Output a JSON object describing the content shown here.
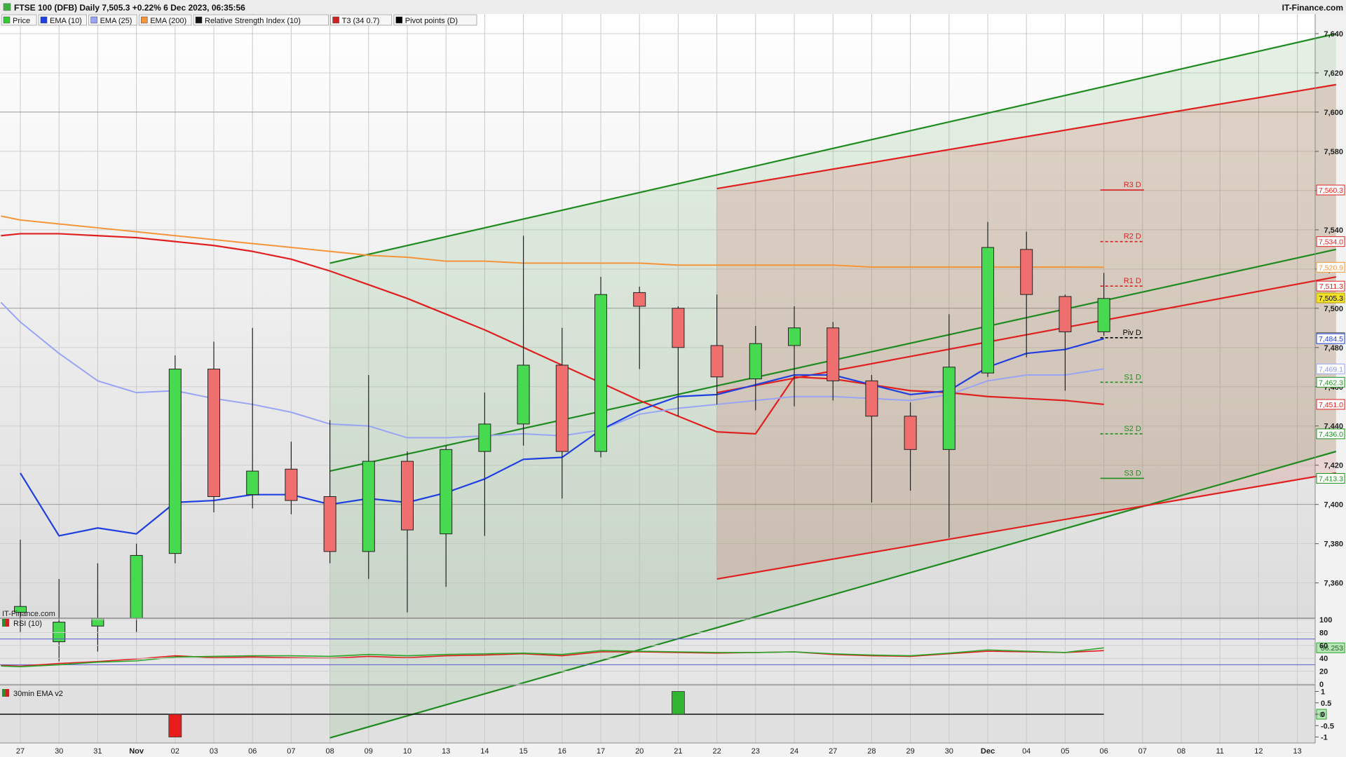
{
  "header": {
    "title": "FTSE 100 (DFB) Daily 7,505.3 +0.22% 6 Dec 2023, 06:35:56",
    "brand": "IT-Finance.com"
  },
  "legend": [
    {
      "label": "Price",
      "color": "#33cc33"
    },
    {
      "label": "EMA (10)",
      "color": "#1f3fe0"
    },
    {
      "label": "EMA (25)",
      "color": "#9aa4f4"
    },
    {
      "label": "EMA (200)",
      "color": "#f5953a"
    },
    {
      "label": "Relative Strength Index (10)",
      "color": "#111111"
    },
    {
      "label": "T3 (34 0.7)",
      "color": "#cc2222"
    },
    {
      "label": "Pivot points (D)",
      "color": "#000000"
    }
  ],
  "watermark": "IT-Finance.com",
  "rsi_panel": {
    "label": "RSI (10)",
    "ticks": [
      "100",
      "80",
      "60",
      "40",
      "20",
      "0"
    ],
    "value_label": "56.253"
  },
  "ema_panel": {
    "label": "30min EMA v2",
    "ticks": [
      "1",
      "0.5",
      "0",
      "-0.5",
      "-1"
    ],
    "value_label": "0"
  },
  "chart_data": {
    "type": "candlestick",
    "x_labels": [
      "27",
      "30",
      "31",
      "Nov",
      "02",
      "03",
      "06",
      "07",
      "08",
      "09",
      "10",
      "13",
      "14",
      "15",
      "16",
      "17",
      "20",
      "21",
      "22",
      "23",
      "24",
      "27",
      "28",
      "29",
      "30",
      "Dec",
      "04",
      "05",
      "06",
      "07",
      "08",
      "11",
      "12",
      "13"
    ],
    "ylim": [
      7342,
      7650
    ],
    "y_ticks": [
      7360,
      7380,
      7400,
      7420,
      7440,
      7460,
      7480,
      7500,
      7520,
      7540,
      7560,
      7580,
      7600,
      7620,
      7640
    ],
    "y_tick_labels": [
      "7,360",
      "7,380",
      "7,400",
      "7,420",
      "7,440",
      "7,460",
      "7,480",
      "7,500",
      "7,520",
      "7,540",
      "7,560",
      "7,580",
      "7,600",
      "7,620",
      "7,640"
    ],
    "candles": [
      {
        "i": 0,
        "o": 7345,
        "h": 7382,
        "l": 7335,
        "c": 7348
      },
      {
        "i": 1,
        "o": 7330,
        "h": 7362,
        "l": 7320,
        "c": 7340
      },
      {
        "i": 2,
        "o": 7338,
        "h": 7370,
        "l": 7325,
        "c": 7342
      },
      {
        "i": 3,
        "o": 7342,
        "h": 7380,
        "l": 7335,
        "c": 7374
      },
      {
        "i": 4,
        "o": 7375,
        "h": 7476,
        "l": 7370,
        "c": 7469
      },
      {
        "i": 5,
        "o": 7469,
        "h": 7483,
        "l": 7396,
        "c": 7404
      },
      {
        "i": 6,
        "o": 7405,
        "h": 7490,
        "l": 7398,
        "c": 7417
      },
      {
        "i": 7,
        "o": 7418,
        "h": 7432,
        "l": 7395,
        "c": 7402
      },
      {
        "i": 8,
        "o": 7404,
        "h": 7443,
        "l": 7370,
        "c": 7376
      },
      {
        "i": 9,
        "o": 7376,
        "h": 7466,
        "l": 7362,
        "c": 7422
      },
      {
        "i": 10,
        "o": 7422,
        "h": 7427,
        "l": 7345,
        "c": 7387
      },
      {
        "i": 11,
        "o": 7385,
        "h": 7430,
        "l": 7358,
        "c": 7428
      },
      {
        "i": 12,
        "o": 7427,
        "h": 7457,
        "l": 7384,
        "c": 7441
      },
      {
        "i": 13,
        "o": 7441,
        "h": 7537,
        "l": 7430,
        "c": 7471
      },
      {
        "i": 14,
        "o": 7471,
        "h": 7490,
        "l": 7403,
        "c": 7427
      },
      {
        "i": 15,
        "o": 7427,
        "h": 7516,
        "l": 7424,
        "c": 7507
      },
      {
        "i": 16,
        "o": 7508,
        "h": 7511,
        "l": 7469,
        "c": 7501
      },
      {
        "i": 17,
        "o": 7500,
        "h": 7501,
        "l": 7445,
        "c": 7480
      },
      {
        "i": 18,
        "o": 7481,
        "h": 7507,
        "l": 7451,
        "c": 7465
      },
      {
        "i": 19,
        "o": 7464,
        "h": 7491,
        "l": 7448,
        "c": 7482
      },
      {
        "i": 20,
        "o": 7481,
        "h": 7501,
        "l": 7450,
        "c": 7490
      },
      {
        "i": 21,
        "o": 7490,
        "h": 7493,
        "l": 7453,
        "c": 7463
      },
      {
        "i": 22,
        "o": 7463,
        "h": 7466,
        "l": 7401,
        "c": 7445
      },
      {
        "i": 23,
        "o": 7445,
        "h": 7452,
        "l": 7407,
        "c": 7428
      },
      {
        "i": 24,
        "o": 7428,
        "h": 7497,
        "l": 7383,
        "c": 7470
      },
      {
        "i": 25,
        "o": 7467,
        "h": 7544,
        "l": 7465,
        "c": 7531
      },
      {
        "i": 26,
        "o": 7530,
        "h": 7539,
        "l": 7475,
        "c": 7507
      },
      {
        "i": 27,
        "o": 7506,
        "h": 7507,
        "l": 7458,
        "c": 7488
      },
      {
        "i": 28,
        "o": 7488,
        "h": 7518,
        "l": 7486,
        "c": 7505
      }
    ],
    "ema10": [
      [
        0,
        7416
      ],
      [
        1,
        7384
      ],
      [
        2,
        7388
      ],
      [
        3,
        7385
      ],
      [
        4,
        7401
      ],
      [
        5,
        7402
      ],
      [
        6,
        7405
      ],
      [
        7,
        7405
      ],
      [
        8,
        7400
      ],
      [
        9,
        7403
      ],
      [
        10,
        7401
      ],
      [
        11,
        7406
      ],
      [
        12,
        7413
      ],
      [
        13,
        7423
      ],
      [
        14,
        7424
      ],
      [
        15,
        7438
      ],
      [
        16,
        7448
      ],
      [
        17,
        7455
      ],
      [
        18,
        7456
      ],
      [
        19,
        7461
      ],
      [
        20,
        7466
      ],
      [
        21,
        7466
      ],
      [
        22,
        7461
      ],
      [
        23,
        7456
      ],
      [
        24,
        7458
      ],
      [
        25,
        7470
      ],
      [
        26,
        7477
      ],
      [
        27,
        7479
      ],
      [
        28,
        7484.5
      ]
    ],
    "ema25": [
      [
        -0.5,
        7503
      ],
      [
        0,
        7493
      ],
      [
        1,
        7477
      ],
      [
        2,
        7463
      ],
      [
        3,
        7457
      ],
      [
        4,
        7458
      ],
      [
        5,
        7454
      ],
      [
        6,
        7451
      ],
      [
        7,
        7447
      ],
      [
        8,
        7441
      ],
      [
        9,
        7440
      ],
      [
        10,
        7434
      ],
      [
        11,
        7434
      ],
      [
        12,
        7435
      ],
      [
        13,
        7436
      ],
      [
        14,
        7435
      ],
      [
        15,
        7438
      ],
      [
        16,
        7446
      ],
      [
        17,
        7449
      ],
      [
        18,
        7451
      ],
      [
        19,
        7453
      ],
      [
        20,
        7455
      ],
      [
        21,
        7455
      ],
      [
        22,
        7454
      ],
      [
        23,
        7453
      ],
      [
        24,
        7456
      ],
      [
        25,
        7463
      ],
      [
        26,
        7466
      ],
      [
        27,
        7466
      ],
      [
        28,
        7469.1
      ]
    ],
    "ema200": [
      [
        -0.5,
        7547
      ],
      [
        0,
        7545
      ],
      [
        1,
        7543
      ],
      [
        2,
        7541
      ],
      [
        3,
        7539
      ],
      [
        4,
        7537
      ],
      [
        5,
        7535
      ],
      [
        6,
        7533
      ],
      [
        7,
        7531
      ],
      [
        8,
        7529
      ],
      [
        9,
        7527
      ],
      [
        10,
        7526
      ],
      [
        11,
        7524
      ],
      [
        12,
        7524
      ],
      [
        13,
        7523
      ],
      [
        14,
        7523
      ],
      [
        15,
        7523
      ],
      [
        16,
        7523
      ],
      [
        17,
        7522
      ],
      [
        18,
        7522
      ],
      [
        19,
        7522
      ],
      [
        20,
        7522
      ],
      [
        21,
        7522
      ],
      [
        22,
        7521
      ],
      [
        23,
        7521
      ],
      [
        24,
        7521
      ],
      [
        25,
        7521
      ],
      [
        26,
        7521
      ],
      [
        27,
        7521
      ],
      [
        28,
        7520.9
      ]
    ],
    "t3": [
      [
        -0.5,
        7537
      ],
      [
        0,
        7538
      ],
      [
        1,
        7538
      ],
      [
        2,
        7537
      ],
      [
        3,
        7536
      ],
      [
        4,
        7534
      ],
      [
        5,
        7532
      ],
      [
        6,
        7529
      ],
      [
        7,
        7525
      ],
      [
        8,
        7519
      ],
      [
        9,
        7512
      ],
      [
        10,
        7505
      ],
      [
        11,
        7497
      ],
      [
        12,
        7489
      ],
      [
        13,
        7480
      ],
      [
        14,
        7471
      ],
      [
        15,
        7462
      ],
      [
        16,
        7453
      ],
      [
        17,
        7445
      ],
      [
        18,
        7437
      ],
      [
        19,
        7436
      ],
      [
        20,
        7465
      ],
      [
        21,
        7464
      ],
      [
        22,
        7461
      ],
      [
        23,
        7458
      ],
      [
        24,
        7457
      ],
      [
        25,
        7455
      ],
      [
        26,
        7454
      ],
      [
        27,
        7453
      ],
      [
        28,
        7451.0
      ]
    ],
    "channels": {
      "green_zone": {
        "x0": 8,
        "x1": 34,
        "upper": [
          7523,
          7640
        ],
        "mid": [
          7417,
          7530
        ],
        "lower": [
          7281,
          7427
        ]
      },
      "red_zone": {
        "x0": 18,
        "x1": 34,
        "upper": [
          7561,
          7614
        ],
        "mid": [
          7457,
          7516
        ],
        "lower": [
          7362,
          7416
        ]
      }
    },
    "pivots": [
      {
        "label": "R3 D",
        "value": 7560.3,
        "color": "#e02020"
      },
      {
        "label": "R2 D",
        "value": 7534.0,
        "color": "#e02020"
      },
      {
        "label": "R1 D",
        "value": 7511.3,
        "color": "#e02020"
      },
      {
        "label": "Piv D",
        "value": 7485.0,
        "color": "#000000"
      },
      {
        "label": "S1 D",
        "value": 7462.3,
        "color": "#1f8f1f"
      },
      {
        "label": "S2 D",
        "value": 7436.0,
        "color": "#1f8f1f"
      },
      {
        "label": "S3 D",
        "value": 7413.3,
        "color": "#1f8f1f"
      }
    ],
    "axis_tags": [
      {
        "text": "7,560.3",
        "value": 7560.3,
        "bg": "#ffffff",
        "fg": "#e02020",
        "border": "#e02020"
      },
      {
        "text": "7,534.0",
        "value": 7534.0,
        "bg": "#ffffff",
        "fg": "#e02020",
        "border": "#e02020"
      },
      {
        "text": "7,520.9",
        "value": 7520.9,
        "bg": "#ffffff",
        "fg": "#f5953a",
        "border": "#f5953a"
      },
      {
        "text": "7,511.3",
        "value": 7511.3,
        "bg": "#ffffff",
        "fg": "#e02020",
        "border": "#e02020"
      },
      {
        "text": "7,505.3",
        "value": 7505.3,
        "bg": "#f4e12a",
        "fg": "#000000",
        "border": "#b49f00"
      },
      {
        "text": "7,485.0",
        "value": 7485.0,
        "bg": "#ffffff",
        "fg": "#000000",
        "border": "#444444"
      },
      {
        "text": "7,484.5",
        "value": 7484.5,
        "bg": "#ffffff",
        "fg": "#1f3fe0",
        "border": "#1f3fe0"
      },
      {
        "text": "7,469.1",
        "value": 7469.1,
        "bg": "#ffffff",
        "fg": "#8f97ee",
        "border": "#9aa4f4"
      },
      {
        "text": "7,462.3",
        "value": 7462.3,
        "bg": "#ffffff",
        "fg": "#1f8f1f",
        "border": "#1f8f1f"
      },
      {
        "text": "7,451.0",
        "value": 7451.0,
        "bg": "#ffffff",
        "fg": "#e02020",
        "border": "#e02020"
      },
      {
        "text": "7,436.0",
        "value": 7436.0,
        "bg": "#ffffff",
        "fg": "#1f8f1f",
        "border": "#1f8f1f"
      },
      {
        "text": "7,413.3",
        "value": 7413.3,
        "bg": "#ffffff",
        "fg": "#1f8f1f",
        "border": "#1f8f1f"
      }
    ],
    "rsi": {
      "ylim": [
        0,
        100
      ],
      "levels": [
        70,
        30
      ],
      "rsi": [
        [
          -0.5,
          28
        ],
        [
          0,
          27
        ],
        [
          1,
          30
        ],
        [
          2,
          34
        ],
        [
          3,
          36
        ],
        [
          4,
          42
        ],
        [
          5,
          43
        ],
        [
          6,
          44
        ],
        [
          7,
          44
        ],
        [
          8,
          43
        ],
        [
          9,
          46
        ],
        [
          10,
          44
        ],
        [
          11,
          46
        ],
        [
          12,
          47
        ],
        [
          13,
          48
        ],
        [
          14,
          46
        ],
        [
          15,
          52
        ],
        [
          16,
          51
        ],
        [
          17,
          50
        ],
        [
          18,
          49
        ],
        [
          19,
          49
        ],
        [
          20,
          50
        ],
        [
          21,
          47
        ],
        [
          22,
          45
        ],
        [
          23,
          44
        ],
        [
          24,
          48
        ],
        [
          25,
          53
        ],
        [
          26,
          51
        ],
        [
          27,
          49
        ],
        [
          28,
          56.253
        ]
      ],
      "signal": [
        [
          -0.5,
          29
        ],
        [
          0,
          28
        ],
        [
          1,
          32
        ],
        [
          2,
          35
        ],
        [
          3,
          39
        ],
        [
          4,
          44
        ],
        [
          5,
          41
        ],
        [
          6,
          42
        ],
        [
          7,
          41
        ],
        [
          8,
          40
        ],
        [
          9,
          43
        ],
        [
          10,
          41
        ],
        [
          11,
          44
        ],
        [
          12,
          45
        ],
        [
          13,
          47
        ],
        [
          14,
          44
        ],
        [
          15,
          50
        ],
        [
          16,
          50
        ],
        [
          17,
          49
        ],
        [
          18,
          48
        ],
        [
          19,
          49
        ],
        [
          20,
          50
        ],
        [
          21,
          46
        ],
        [
          22,
          44
        ],
        [
          23,
          43
        ],
        [
          24,
          47
        ],
        [
          25,
          51
        ],
        [
          26,
          50
        ],
        [
          27,
          49
        ],
        [
          28,
          52
        ]
      ]
    },
    "ema_signal": {
      "ylim": [
        -1.2,
        1.2
      ],
      "bars": [
        {
          "i": 4,
          "value": -1
        },
        {
          "i": 17,
          "value": 1
        }
      ]
    }
  }
}
